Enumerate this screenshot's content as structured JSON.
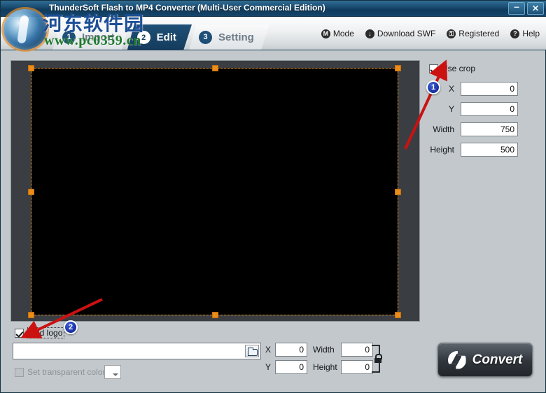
{
  "window": {
    "title": "ThunderSoft Flash to MP4 Converter (Multi-User Commercial Edition)",
    "minimize_label": "–",
    "close_label": "✕"
  },
  "watermark": {
    "site_name": "河东软件园",
    "url": "www.pc0359.cn"
  },
  "tabs": [
    {
      "number": "1",
      "label": "Import",
      "active": false
    },
    {
      "number": "2",
      "label": "Edit",
      "active": true
    },
    {
      "number": "3",
      "label": "Setting",
      "active": false
    }
  ],
  "menu": [
    {
      "icon": "mode-icon",
      "glyph": "M",
      "label": "Mode"
    },
    {
      "icon": "download-icon",
      "glyph": "↓",
      "label": "Download SWF"
    },
    {
      "icon": "key-icon",
      "glyph": "⚿",
      "label": "Registered"
    },
    {
      "icon": "help-icon",
      "glyph": "?",
      "label": "Help"
    }
  ],
  "crop_panel": {
    "use_crop_label": "Use crop",
    "use_crop_checked": true,
    "fields": [
      {
        "label": "X",
        "value": "0"
      },
      {
        "label": "Y",
        "value": "0"
      },
      {
        "label": "Width",
        "value": "750"
      },
      {
        "label": "Height",
        "value": "500"
      }
    ]
  },
  "logo_panel": {
    "add_logo_label": "Add logo",
    "add_logo_checked": true,
    "path_value": "",
    "browse_icon": "folder-open-icon",
    "transparent_color_label": "Set transparent color",
    "transparent_color_checked": false,
    "transparent_color_enabled": false,
    "swatch_color": "#ffffff",
    "position": {
      "x_label": "X",
      "x_value": "0",
      "y_label": "Y",
      "y_value": "0",
      "width_label": "Width",
      "width_value": "0",
      "height_label": "Height",
      "height_value": "0",
      "lock_icon": "aspect-lock-icon"
    }
  },
  "convert": {
    "label": "Convert",
    "icon": "refresh-convert-icon"
  },
  "annotations": [
    {
      "number": "1",
      "target": "use-crop-checkbox"
    },
    {
      "number": "2",
      "target": "add-logo-checkbox"
    }
  ],
  "colors": {
    "titlebar": "#1d4f75",
    "panel_bg": "#c2c8cc",
    "accent_tab": "#143b5c",
    "crop_handle": "#ed8c18",
    "annotation": "#cc1111"
  }
}
